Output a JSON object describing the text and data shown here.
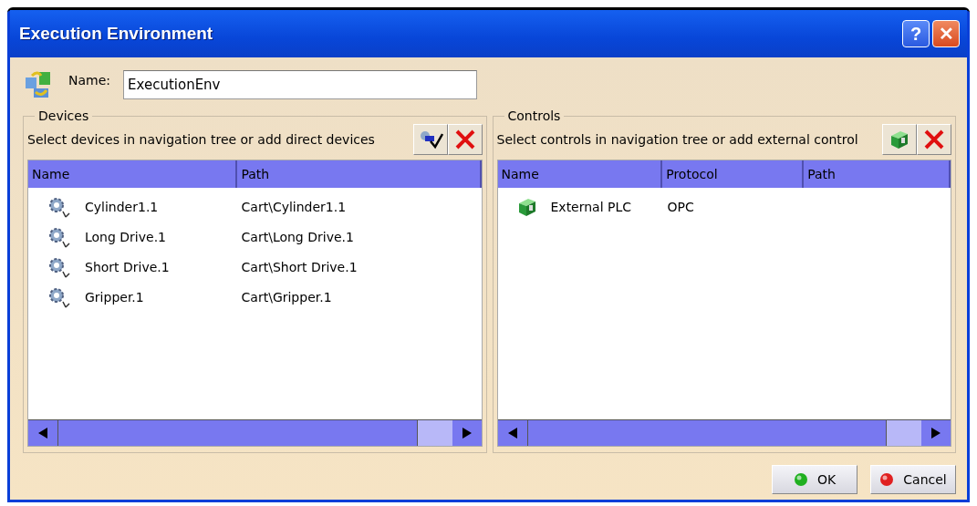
{
  "window": {
    "title": "Execution Environment",
    "help_label": "?",
    "close_label": "✕"
  },
  "name_field": {
    "label": "Name:",
    "value": "ExecutionEnv"
  },
  "devices": {
    "legend": "Devices",
    "hint": "Select devices in navigation tree or add direct devices",
    "columns": [
      "Name",
      "Path"
    ],
    "rows": [
      {
        "name": "Cylinder1.1",
        "path": "Cart\\Cylinder1.1"
      },
      {
        "name": "Long Drive.1",
        "path": "Cart\\Long Drive.1"
      },
      {
        "name": "Short Drive.1",
        "path": "Cart\\Short Drive.1"
      },
      {
        "name": "Gripper.1",
        "path": "Cart\\Gripper.1"
      }
    ]
  },
  "controls": {
    "legend": "Controls",
    "hint": "Select controls in navigation tree or add external control",
    "columns": [
      "Name",
      "Protocol",
      "Path"
    ],
    "rows": [
      {
        "name": "External PLC",
        "protocol": "OPC"
      }
    ]
  },
  "buttons": [
    {
      "label": "OK",
      "kind": "ok"
    },
    {
      "label": "Cancel",
      "kind": "cancel"
    }
  ]
}
